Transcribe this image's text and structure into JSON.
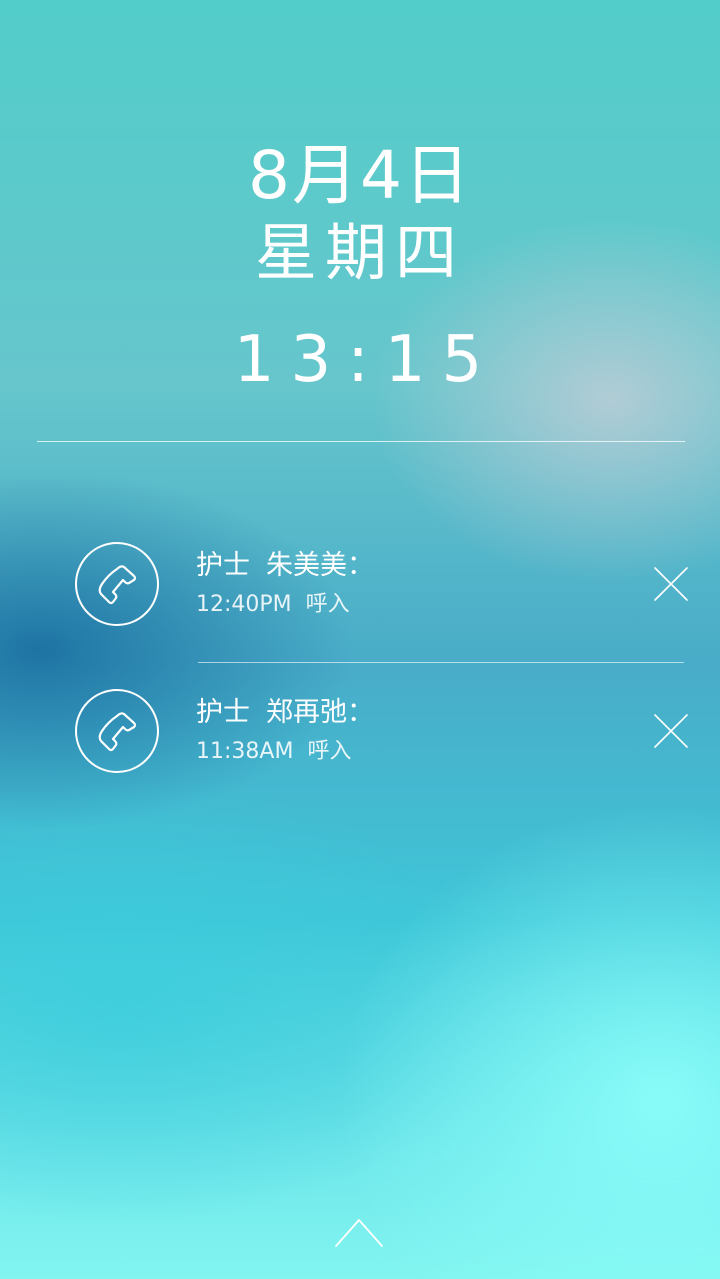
{
  "clock": {
    "date": "8月4日",
    "weekday": "星期四",
    "time": "13:15"
  },
  "notifications": [
    {
      "role": "护士",
      "name": "朱美美：",
      "time": "12:40PM",
      "type": "呼入",
      "icon": "phone-icon"
    },
    {
      "role": "护士",
      "name": "郑再弛：",
      "time": "11:38AM",
      "type": "呼入",
      "icon": "phone-icon"
    }
  ],
  "unlock": {
    "icon": "chevron-up-icon"
  }
}
